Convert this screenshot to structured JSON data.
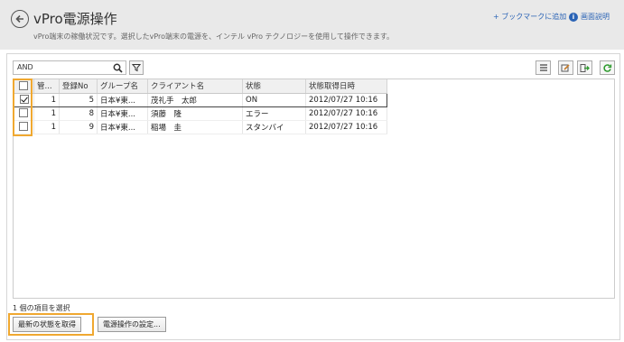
{
  "header": {
    "title": "vPro電源操作",
    "subtitle": "vPro端末の稼働状況です。選択したvPro端末の電源を、インテル vPro テクノロジーを使用して操作できます。",
    "bookmark": "+ ブックマークに追加",
    "help": "画面説明"
  },
  "search": {
    "value": "AND"
  },
  "table": {
    "columns": [
      "",
      "管...",
      "登録No",
      "グループ名",
      "クライアント名",
      "状態",
      "状態取得日時"
    ],
    "rows": [
      {
        "checked": true,
        "kan": "1",
        "no": "5",
        "group": "日本¥東...",
        "client": "茂礼手　太郎",
        "state": "ON",
        "time": "2012/07/27 10:16"
      },
      {
        "checked": false,
        "kan": "1",
        "no": "8",
        "group": "日本¥東...",
        "client": "須藤　隆",
        "state": "エラー",
        "time": "2012/07/27 10:16"
      },
      {
        "checked": false,
        "kan": "1",
        "no": "9",
        "group": "日本¥東...",
        "client": "稲場　圭",
        "state": "スタンバイ",
        "time": "2012/07/27 10:16"
      }
    ]
  },
  "footer": {
    "status": "1 個の項目を選択",
    "refresh_button": "最新の状態を取得",
    "settings_button": "電源操作の設定..."
  },
  "colors": {
    "accent": "#2a63b5",
    "highlight": "#f0a830"
  }
}
